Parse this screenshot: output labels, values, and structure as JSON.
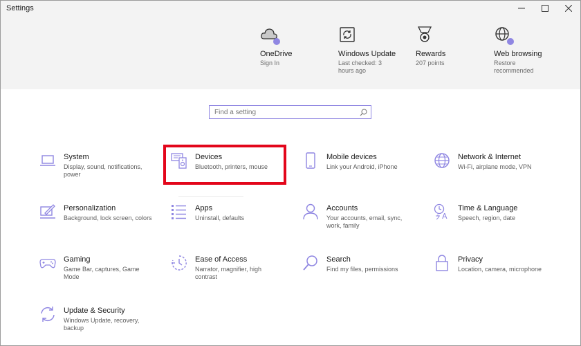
{
  "window": {
    "title": "Settings"
  },
  "quick_links": [
    {
      "icon": "onedrive-cloud-icon",
      "title": "OneDrive",
      "subtitle": "Sign In",
      "has_dot": true
    },
    {
      "icon": "windows-update-icon",
      "title": "Windows Update",
      "subtitle": "Last checked: 3 hours ago",
      "has_dot": false
    },
    {
      "icon": "rewards-icon",
      "title": "Rewards",
      "subtitle": "207 points",
      "has_dot": false
    },
    {
      "icon": "web-browsing-globe-icon",
      "title": "Web browsing",
      "subtitle": "Restore recommended",
      "has_dot": true
    }
  ],
  "search": {
    "placeholder": "Find a setting",
    "value": ""
  },
  "categories": [
    {
      "icon": "laptop-icon",
      "title": "System",
      "subtitle": "Display, sound, notifications, power"
    },
    {
      "icon": "devices-keyboard-speaker-icon",
      "title": "Devices",
      "subtitle": "Bluetooth, printers, mouse"
    },
    {
      "icon": "phone-icon",
      "title": "Mobile devices",
      "subtitle": "Link your Android, iPhone"
    },
    {
      "icon": "globe-icon",
      "title": "Network & Internet",
      "subtitle": "Wi-Fi, airplane mode, VPN"
    },
    {
      "icon": "personalization-pen-icon",
      "title": "Personalization",
      "subtitle": "Background, lock screen, colors"
    },
    {
      "icon": "apps-list-icon",
      "title": "Apps",
      "subtitle": "Uninstall, defaults"
    },
    {
      "icon": "person-icon",
      "title": "Accounts",
      "subtitle": "Your accounts, email, sync, work, family"
    },
    {
      "icon": "time-language-icon",
      "title": "Time & Language",
      "subtitle": "Speech, region, date"
    },
    {
      "icon": "gamepad-icon",
      "title": "Gaming",
      "subtitle": "Game Bar, captures, Game Mode"
    },
    {
      "icon": "ease-of-access-icon",
      "title": "Ease of Access",
      "subtitle": "Narrator, magnifier, high contrast"
    },
    {
      "icon": "search-icon",
      "title": "Search",
      "subtitle": "Find my files, permissions"
    },
    {
      "icon": "lock-icon",
      "title": "Privacy",
      "subtitle": "Location, camera, microphone"
    },
    {
      "icon": "update-security-sync-icon",
      "title": "Update & Security",
      "subtitle": "Windows Update, recovery, backup"
    }
  ],
  "colors": {
    "accent": "#8f86e2",
    "highlight": "#e3061b",
    "band": "#f3f3f3"
  }
}
